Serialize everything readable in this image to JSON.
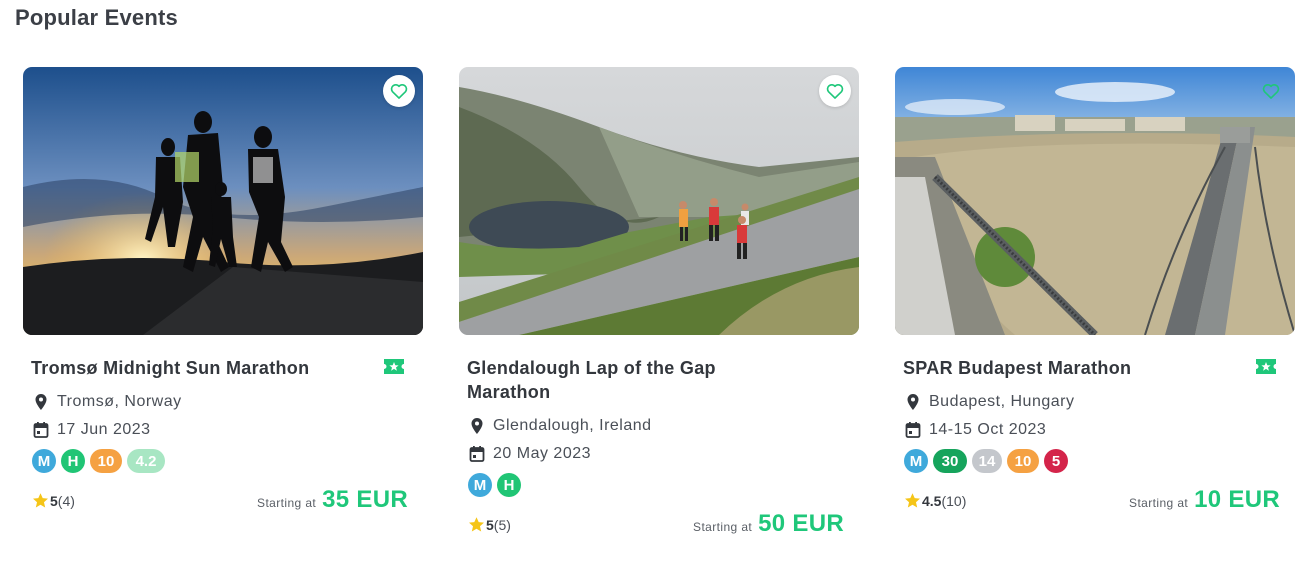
{
  "section": {
    "title": "Popular Events"
  },
  "price_label": "Starting at",
  "events": [
    {
      "title": "Tromsø Midnight Sun Marathon",
      "location": "Tromsø, Norway",
      "date": "17 Jun 2023",
      "badges": [
        "M",
        "H",
        "10",
        "4.2"
      ],
      "rating": "5",
      "reviews": "(4)",
      "price": "35 EUR",
      "ticket_icon": "ticket-star-icon"
    },
    {
      "title": "Glendalough Lap of the Gap Marathon",
      "location": "Glendalough, Ireland",
      "date": "20 May 2023",
      "badges": [
        "M",
        "H"
      ],
      "rating": "5",
      "reviews": "(5)",
      "price": "50 EUR"
    },
    {
      "title": "SPAR Budapest Marathon",
      "location": "Budapest, Hungary",
      "date": "14-15 Oct 2023",
      "badges": [
        "M",
        "30",
        "14",
        "10",
        "5"
      ],
      "rating": "4.5",
      "reviews": "(10)",
      "price": "10 EUR",
      "ticket_icon": "ticket-star-icon"
    }
  ],
  "colors": {
    "accent": "#1fc77a",
    "badge_blue": "#3fa9db",
    "badge_green": "#20c575",
    "badge_orange": "#f5a142",
    "badge_red": "#d4244a",
    "star": "#f5c518"
  }
}
